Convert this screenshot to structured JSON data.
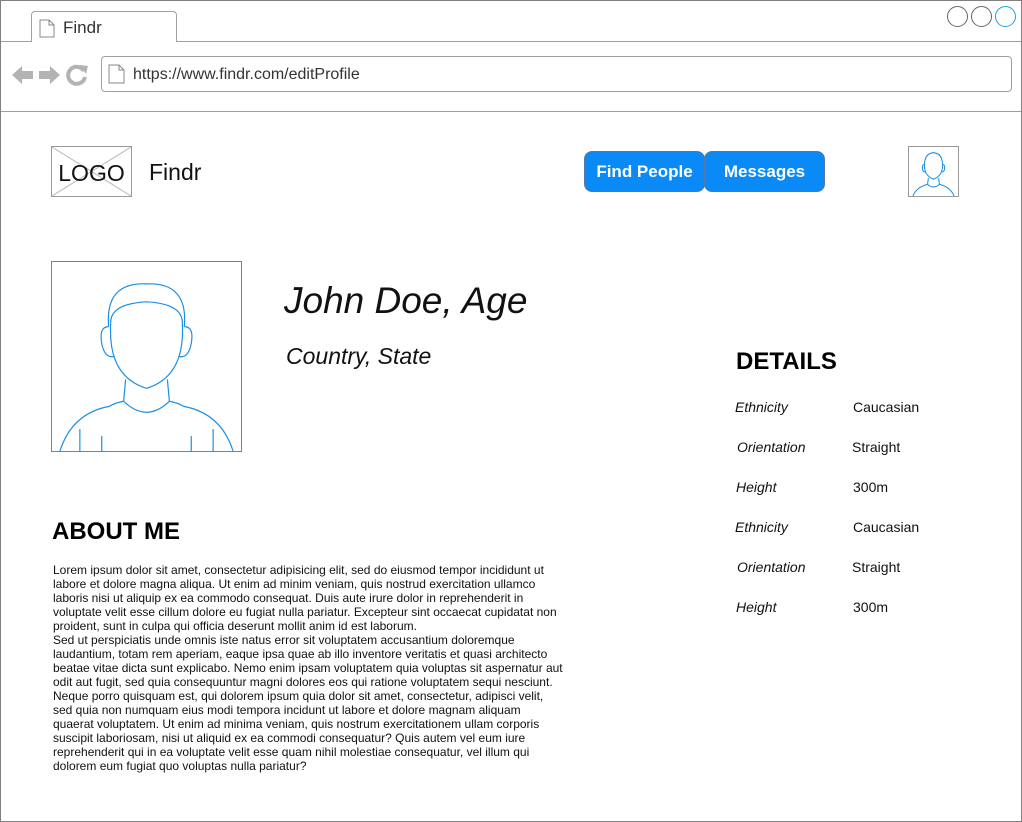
{
  "browser": {
    "tab_title": "Findr",
    "url": "https://www.findr.com/editProfile"
  },
  "header": {
    "logo_text": "LOGO",
    "brand": "Findr",
    "nav": {
      "find_people": "Find People",
      "messages": "Messages"
    }
  },
  "profile": {
    "name": "John Doe, Age",
    "location": "Country, State"
  },
  "about": {
    "heading": "ABOUT ME",
    "paragraphs": [
      "Lorem ipsum dolor sit amet, consectetur adipisicing elit, sed do eiusmod tempor incididunt ut labore et dolore magna aliqua. Ut enim ad minim veniam, quis nostrud exercitation ullamco laboris nisi ut aliquip ex ea commodo consequat. Duis aute irure dolor in reprehenderit in voluptate velit esse cillum dolore eu fugiat nulla pariatur. Excepteur sint occaecat cupidatat non proident, sunt in culpa qui officia deserunt mollit anim id est laborum.",
      "Sed ut perspiciatis unde omnis iste natus error sit voluptatem accusantium doloremque laudantium, totam rem aperiam, eaque ipsa quae ab illo inventore veritatis et quasi architecto beatae vitae dicta sunt explicabo. Nemo enim ipsam voluptatem quia voluptas sit aspernatur aut odit aut fugit, sed quia consequuntur magni dolores eos qui ratione voluptatem sequi nesciunt. Neque porro quisquam est, qui dolorem ipsum quia dolor sit amet, consectetur, adipisci velit, sed quia non numquam eius modi tempora incidunt ut labore et dolore magnam aliquam quaerat voluptatem. Ut enim ad minima veniam, quis nostrum exercitationem ullam corporis suscipit laboriosam, nisi ut aliquid ex ea commodi consequatur? Quis autem vel eum iure reprehenderit qui in ea voluptate velit esse quam nihil molestiae consequatur, vel illum qui dolorem eum fugiat quo voluptas nulla pariatur?"
    ]
  },
  "details": {
    "heading": "DETAILS",
    "rows": [
      {
        "label": "Ethnicity",
        "value": "Caucasian"
      },
      {
        "label": "Orientation",
        "value": "Straight"
      },
      {
        "label": "Height",
        "value": "300m"
      },
      {
        "label": "Ethnicity",
        "value": "Caucasian"
      },
      {
        "label": "Orientation",
        "value": "Straight"
      },
      {
        "label": "Height",
        "value": "300m"
      }
    ]
  },
  "colors": {
    "button_blue": "#0a8af7",
    "avatar_line": "#1a8fe3"
  }
}
